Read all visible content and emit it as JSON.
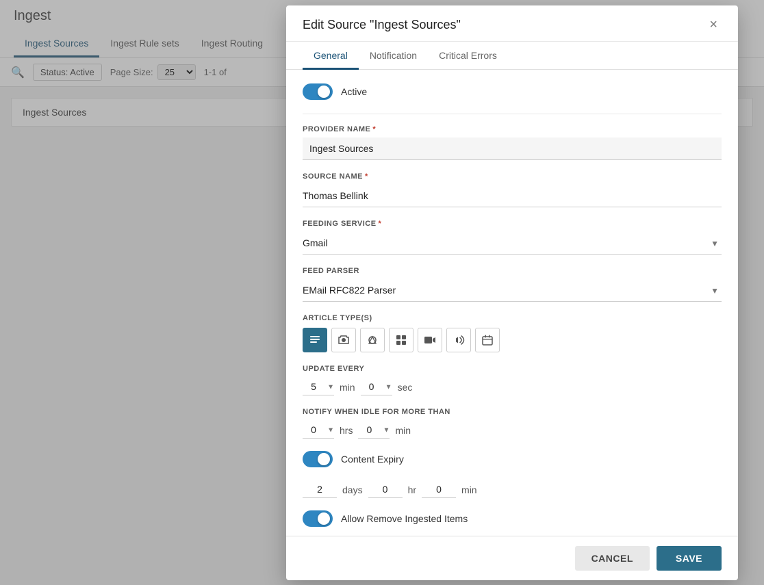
{
  "app": {
    "title": "Ingest"
  },
  "background": {
    "tabs": [
      {
        "label": "Ingest Sources",
        "active": true
      },
      {
        "label": "Ingest Rule sets",
        "active": false
      },
      {
        "label": "Ingest Routing",
        "active": false
      }
    ],
    "toolbar": {
      "status_label": "Status: Active",
      "page_size_label": "Page Size:",
      "page_size_value": "25",
      "pagination": "1-1 of"
    },
    "list_item": "Ingest Sources"
  },
  "modal": {
    "title": "Edit Source \"Ingest Sources\"",
    "close_label": "×",
    "tabs": [
      {
        "label": "General",
        "active": true
      },
      {
        "label": "Notification",
        "active": false
      },
      {
        "label": "Critical Errors",
        "active": false
      }
    ],
    "active_toggle_label": "Active",
    "active_toggle_on": true,
    "provider_name_label": "PROVIDER NAME",
    "provider_name_value": "Ingest Sources",
    "source_name_label": "SOURCE NAME",
    "source_name_value": "Thomas Bellink",
    "feeding_service_label": "FEEDING SERVICE",
    "feeding_service_value": "Gmail",
    "feed_parser_label": "FEED PARSER",
    "feed_parser_value": "EMail RFC822 Parser",
    "article_types_label": "ARTICLE TYPE(S)",
    "article_types": [
      {
        "icon": "▤",
        "active": true,
        "name": "text"
      },
      {
        "icon": "📷",
        "active": false,
        "name": "photo"
      },
      {
        "icon": "📷",
        "active": false,
        "name": "graphic"
      },
      {
        "icon": "▦",
        "active": false,
        "name": "composite"
      },
      {
        "icon": "▶",
        "active": false,
        "name": "video"
      },
      {
        "icon": "🔊",
        "active": false,
        "name": "audio"
      },
      {
        "icon": "📅",
        "active": false,
        "name": "event"
      }
    ],
    "update_every_label": "UPDATE EVERY",
    "update_every_min": "5",
    "update_every_sec": "0",
    "update_every_min_unit": "min",
    "update_every_sec_unit": "sec",
    "notify_idle_label": "NOTIFY WHEN IDLE FOR MORE THAN",
    "notify_idle_hrs": "0",
    "notify_idle_min": "0",
    "notify_idle_hrs_unit": "hrs",
    "notify_idle_min_unit": "min",
    "content_expiry_label": "Content Expiry",
    "content_expiry_on": true,
    "content_expiry_days": "2",
    "content_expiry_days_unit": "days",
    "content_expiry_hr": "0",
    "content_expiry_hr_unit": "hr",
    "content_expiry_min": "0",
    "content_expiry_min_unit": "min",
    "allow_remove_label": "Allow Remove Ingested Items",
    "allow_remove_on": true,
    "footer": {
      "cancel_label": "CANCEL",
      "save_label": "SAVE"
    }
  }
}
